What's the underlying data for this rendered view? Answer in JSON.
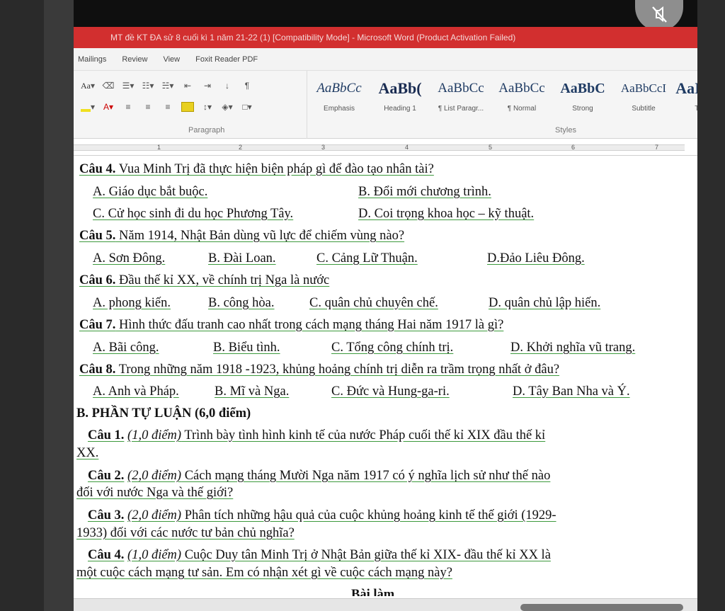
{
  "window": {
    "title": "MT  đề KT  ĐA  sử 8  cuối kì 1  năm 21-22  (1) [Compatibility Mode]  -  Microsoft Word (Product Activation Failed)"
  },
  "ribbon": {
    "tabs": [
      "Mailings",
      "Review",
      "View",
      "Foxit Reader PDF"
    ],
    "paragraph_label": "Paragraph",
    "styles_label": "Styles",
    "styles": [
      {
        "sample": "AaBbCc",
        "name": "Emphasis"
      },
      {
        "sample": "AaBb(",
        "name": "Heading 1"
      },
      {
        "sample": "AaBbCc",
        "name": "¶ List Paragr..."
      },
      {
        "sample": "AaBbCc",
        "name": "¶ Normal"
      },
      {
        "sample": "AaBbC",
        "name": "Strong"
      },
      {
        "sample": "AaBbCcI",
        "name": "Subtitle"
      },
      {
        "sample": "AaI",
        "name": "Tit"
      }
    ],
    "font_size_btn": "Aa",
    "pilcrow": "¶"
  },
  "ruler": {
    "numbers": [
      "1",
      "2",
      "3",
      "4",
      "5",
      "6",
      "7"
    ]
  },
  "document": {
    "q4": {
      "label": "Câu 4.",
      "text": " Vua Minh Trị đã thực hiện biện pháp gì để đào tạo nhân tài?",
      "a": "A. Giáo dục bắt buộc.",
      "b": "B. Đổi mới chương trình.",
      "c": "C. Cử học sinh đi du học Phương Tây.",
      "d": "D. Coi trọng khoa học – kỹ thuật."
    },
    "q5": {
      "label": "Câu 5.",
      "text": " Năm 1914, Nhật Bản dùng vũ lực để chiếm vùng nào?",
      "a": "A. Sơn Đông.",
      "b": "B. Đài Loan.",
      "c": "C. Cảng Lữ Thuận.",
      "d": "D.Đảo Liêu Đông."
    },
    "q6": {
      "label": "Câu 6.",
      "text": " Đầu thế kỉ XX, về chính trị Nga là nước",
      "a": "A. phong kiến.",
      "b": "B. công hòa.",
      "c": "C. quân chủ chuyên chế.",
      "d": "D. quân chủ lập hiến."
    },
    "q7": {
      "label": "Câu 7.",
      "text": " Hình thức đấu tranh cao nhất trong cách mạng tháng Hai năm 1917 là gì?",
      "a": "A. Bãi công.",
      "b": "B. Biểu tình.",
      "c": "C. Tổng công chính trị.",
      "d": "D. Khởi nghĩa vũ trang."
    },
    "q8": {
      "label": "Câu 8.",
      "text": " Trong những năm 1918 -1923, khủng hoảng chính trị diễn ra trầm trọng nhất ở đâu?",
      "a": "A. Anh và Pháp.",
      "b": "B. Mĩ và Nga.",
      "c": "C. Đức và Hung-ga-ri.",
      "d": "D. Tây Ban Nha và Ý."
    },
    "section_b": "B. PHẦN TỰ LUẬN (6,0 điểm)",
    "e1": {
      "label": "Câu 1.",
      "points": "(1,0 điểm)",
      "line1": " Trình bày tình hình kinh tế của nước Pháp cuối thế kỉ XIX đầu thế kỉ",
      "line2": "XX."
    },
    "e2": {
      "label": "Câu 2.",
      "points": "(2,0 điểm)",
      "line1": " Cách mạng tháng Mười Nga năm 1917 có ý nghĩa lịch sử như thế nào",
      "line2": "đối với nước Nga và thế giới?"
    },
    "e3": {
      "label": "Câu 3.",
      "points": "(2,0 điểm)",
      "line1": " Phân tích những hậu quả của cuộc khủng hoảng kinh tế thế giới (1929-",
      "line2": "1933) đối với các nước tư bản chủ nghĩa?"
    },
    "e4": {
      "label": "Câu 4.",
      "points": "(1,0 điểm)",
      "line1": " Cuộc Duy tân Minh Trị ở Nhật Bản giữa thế kỉ XIX- đầu thế kỉ XX là",
      "line2": "một cuộc cách mạng tư sản. Em có nhận xét gì về cuộc cách mạng này?"
    },
    "cut_off": "Bài làm"
  }
}
